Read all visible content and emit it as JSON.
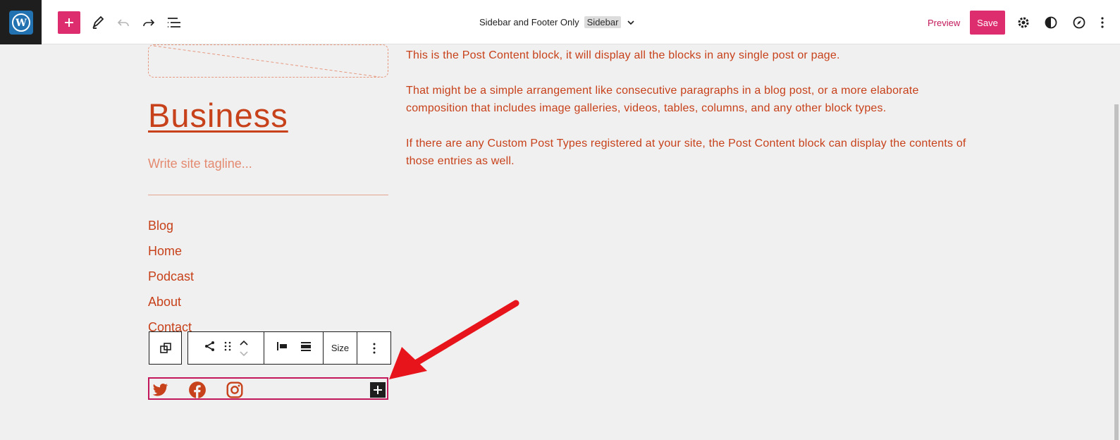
{
  "header": {
    "document_title": "Sidebar and Footer Only",
    "template_badge": "Sidebar",
    "preview_label": "Preview",
    "save_label": "Save"
  },
  "site": {
    "title": "Business",
    "tagline_placeholder": "Write site tagline..."
  },
  "navigation": {
    "items": [
      {
        "label": "Blog"
      },
      {
        "label": "Home"
      },
      {
        "label": "Podcast"
      },
      {
        "label": "About"
      },
      {
        "label": "Contact"
      }
    ]
  },
  "post_content": {
    "paragraphs": [
      "This is the Post Content block, it will display all the blocks in any single post or page.",
      "That might be a simple arrangement like consecutive paragraphs in a blog post, or a more elaborate composition that includes image galleries, videos, tables, columns, and any other block types.",
      "If there are any Custom Post Types registered at your site, the Post Content block can display the contents of those entries as well."
    ]
  },
  "block_toolbar": {
    "size_label": "Size"
  },
  "social_icons": [
    "twitter-icon",
    "facebook-icon",
    "instagram-icon"
  ],
  "colors": {
    "accent": "#dd2d6e",
    "text": "#c7411a",
    "muted": "#e48a70",
    "canvas": "#f0f0f0",
    "annotation_arrow": "#e8141b"
  }
}
